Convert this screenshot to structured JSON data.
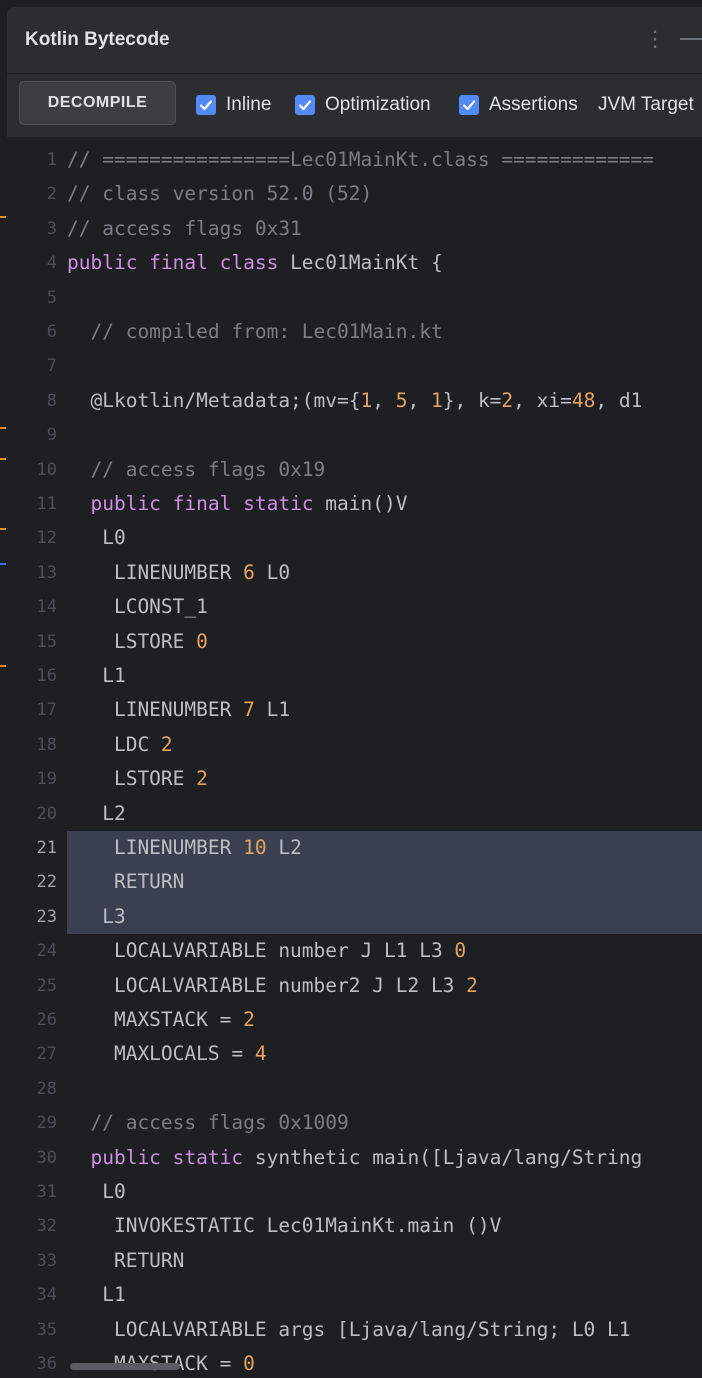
{
  "panel": {
    "title": "Kotlin Bytecode"
  },
  "toolbar": {
    "decompile_label": "DECOMPILE",
    "options": [
      {
        "label": "Inline",
        "checked": true
      },
      {
        "label": "Optimization",
        "checked": true
      },
      {
        "label": "Assertions",
        "checked": true
      },
      {
        "label": "JVM Target",
        "checked": false
      }
    ]
  },
  "colors": {
    "keyword": "#cf8ee0",
    "number": "#e5a15e",
    "comment": "#7a7e85",
    "plain": "#bcbec4",
    "highlight": "#3b4050",
    "accent": "#548af7"
  },
  "editor": {
    "highlighted_lines": [
      21,
      22,
      23
    ],
    "lines": [
      {
        "n": "1",
        "t": [
          [
            "c",
            "// ================Lec01MainKt.class ============="
          ]
        ]
      },
      {
        "n": "2",
        "t": [
          [
            "c",
            "// class version 52.0 (52)"
          ]
        ]
      },
      {
        "n": "3",
        "t": [
          [
            "c",
            "// access flags 0x31"
          ]
        ]
      },
      {
        "n": "4",
        "t": [
          [
            "k",
            "public final class "
          ],
          [
            "p",
            "Lec01MainKt {"
          ]
        ]
      },
      {
        "n": "5",
        "t": []
      },
      {
        "n": "6",
        "t": [
          [
            "p",
            "  "
          ],
          [
            "c",
            "// compiled from: Lec01Main.kt"
          ]
        ]
      },
      {
        "n": "7",
        "t": []
      },
      {
        "n": "8",
        "t": [
          [
            "p",
            "  @Lkotlin/Metadata;(mv={"
          ],
          [
            "n",
            "1"
          ],
          [
            "p",
            ", "
          ],
          [
            "n",
            "5"
          ],
          [
            "p",
            ", "
          ],
          [
            "n",
            "1"
          ],
          [
            "p",
            "}, k="
          ],
          [
            "n",
            "2"
          ],
          [
            "p",
            ", xi="
          ],
          [
            "n",
            "48"
          ],
          [
            "p",
            ", d1"
          ]
        ]
      },
      {
        "n": "9",
        "t": []
      },
      {
        "n": "10",
        "t": [
          [
            "p",
            "  "
          ],
          [
            "c",
            "// access flags 0x19"
          ]
        ]
      },
      {
        "n": "11",
        "t": [
          [
            "p",
            "  "
          ],
          [
            "k",
            "public final static "
          ],
          [
            "p",
            "main()V"
          ]
        ]
      },
      {
        "n": "12",
        "t": [
          [
            "p",
            "   L0"
          ]
        ]
      },
      {
        "n": "13",
        "t": [
          [
            "p",
            "    LINENUMBER "
          ],
          [
            "n",
            "6"
          ],
          [
            "p",
            " L0"
          ]
        ]
      },
      {
        "n": "14",
        "t": [
          [
            "p",
            "    LCONST_1"
          ]
        ]
      },
      {
        "n": "15",
        "t": [
          [
            "p",
            "    LSTORE "
          ],
          [
            "n",
            "0"
          ]
        ]
      },
      {
        "n": "16",
        "t": [
          [
            "p",
            "   L1"
          ]
        ]
      },
      {
        "n": "17",
        "t": [
          [
            "p",
            "    LINENUMBER "
          ],
          [
            "n",
            "7"
          ],
          [
            "p",
            " L1"
          ]
        ]
      },
      {
        "n": "18",
        "t": [
          [
            "p",
            "    LDC "
          ],
          [
            "n",
            "2"
          ]
        ]
      },
      {
        "n": "19",
        "t": [
          [
            "p",
            "    LSTORE "
          ],
          [
            "n",
            "2"
          ]
        ]
      },
      {
        "n": "20",
        "t": [
          [
            "p",
            "   L2"
          ]
        ]
      },
      {
        "n": "21",
        "t": [
          [
            "p",
            "    LINENUMBER "
          ],
          [
            "n",
            "10"
          ],
          [
            "p",
            " L2"
          ]
        ]
      },
      {
        "n": "22",
        "t": [
          [
            "p",
            "    RETURN"
          ]
        ]
      },
      {
        "n": "23",
        "t": [
          [
            "p",
            "   L3"
          ]
        ]
      },
      {
        "n": "24",
        "t": [
          [
            "p",
            "    LOCALVARIABLE number J L1 L3 "
          ],
          [
            "n",
            "0"
          ]
        ]
      },
      {
        "n": "25",
        "t": [
          [
            "p",
            "    LOCALVARIABLE number2 J L2 L3 "
          ],
          [
            "n",
            "2"
          ]
        ]
      },
      {
        "n": "26",
        "t": [
          [
            "p",
            "    MAXSTACK = "
          ],
          [
            "n",
            "2"
          ]
        ]
      },
      {
        "n": "27",
        "t": [
          [
            "p",
            "    MAXLOCALS = "
          ],
          [
            "n",
            "4"
          ]
        ]
      },
      {
        "n": "28",
        "t": []
      },
      {
        "n": "29",
        "t": [
          [
            "p",
            "  "
          ],
          [
            "c",
            "// access flags 0x1009"
          ]
        ]
      },
      {
        "n": "30",
        "t": [
          [
            "p",
            "  "
          ],
          [
            "k",
            "public static "
          ],
          [
            "p",
            "synthetic main([Ljava/lang/String"
          ]
        ]
      },
      {
        "n": "31",
        "t": [
          [
            "p",
            "   L0"
          ]
        ]
      },
      {
        "n": "32",
        "t": [
          [
            "p",
            "    INVOKESTATIC Lec01MainKt.main ()V"
          ]
        ]
      },
      {
        "n": "33",
        "t": [
          [
            "p",
            "    RETURN"
          ]
        ]
      },
      {
        "n": "34",
        "t": [
          [
            "p",
            "   L1"
          ]
        ]
      },
      {
        "n": "35",
        "t": [
          [
            "p",
            "    LOCALVARIABLE args [Ljava/lang/String; L0 L1"
          ]
        ]
      },
      {
        "n": "36",
        "t": [
          [
            "p",
            "    MAXSTACK = "
          ],
          [
            "n",
            "0"
          ]
        ]
      }
    ]
  }
}
